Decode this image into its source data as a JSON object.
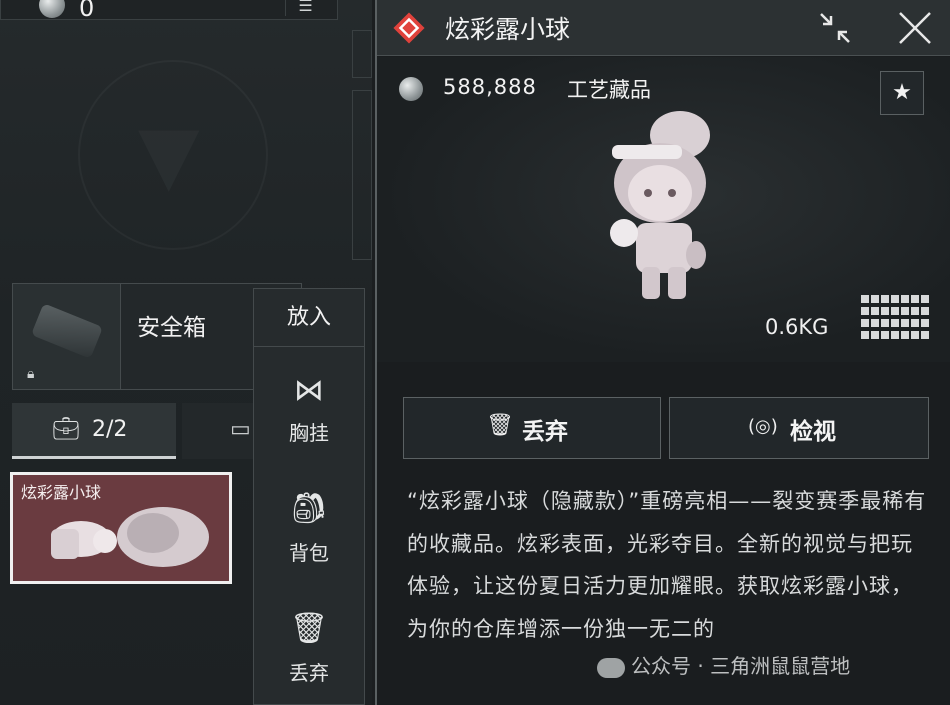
{
  "top_bar": {
    "currency_icon": "coin-icon",
    "currency_amount": "0",
    "menu_icon": "menu-icon"
  },
  "safe_box": {
    "label": "安全箱",
    "lock_icon": "lock-icon"
  },
  "tabs": [
    {
      "icon": "backpack-case-icon",
      "label": "2/2",
      "active": true
    },
    {
      "icon": "container-icon",
      "label": "",
      "active": false
    }
  ],
  "inventory_slot": {
    "name": "炫彩露小球",
    "background_color": "#6a3b40"
  },
  "context_menu": {
    "title": "放入",
    "items": [
      {
        "icon": "bow-icon",
        "label": "胸挂"
      },
      {
        "icon": "backpack-icon",
        "label": "背包"
      },
      {
        "icon": "trash-icon",
        "label": "丢弃"
      }
    ]
  },
  "detail": {
    "title": "炫彩露小球",
    "rarity_color": "#e0423c",
    "price": "588,888",
    "category": "工艺藏品",
    "weight": "0.6KG",
    "buttons": {
      "discard": "丢弃",
      "inspect": "检视"
    },
    "description": "“炫彩露小球（隐藏款）”重磅亮相——裂变赛季最稀有的收藏品。炫彩表面，光彩夺目。全新的视觉与把玩体验，让这份夏日活力更加耀眼。获取炫彩露小球，为你的仓库增添一份独一无二的",
    "credit": "公众号 · 三角洲鼠鼠营地"
  }
}
